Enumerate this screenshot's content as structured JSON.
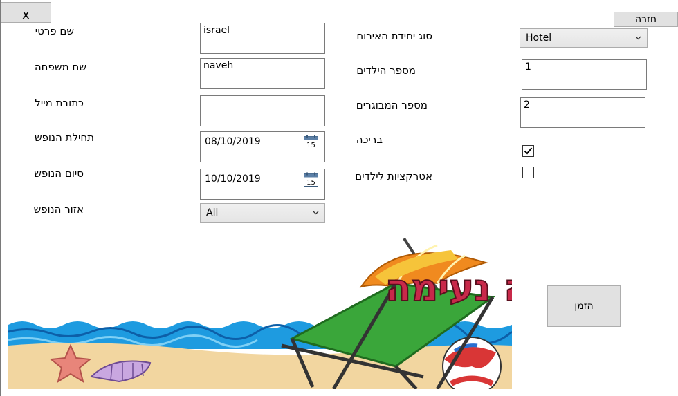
{
  "buttons": {
    "close": "x",
    "back": "חזרה",
    "book": "הזמן"
  },
  "left_form": {
    "first_name": {
      "label": "שם פרטי",
      "value": "israel"
    },
    "last_name": {
      "label": "שם משפחה",
      "value": "naveh"
    },
    "email": {
      "label": "כתובת מייל",
      "value": ""
    },
    "vacation_start": {
      "label": "תחילת הנופש",
      "value": "08/10/2019",
      "calendar_day": "15"
    },
    "vacation_end": {
      "label": "סיום הנופש",
      "value": "10/10/2019",
      "calendar_day": "15"
    },
    "area": {
      "label": "אזור הנופש",
      "value": "All"
    }
  },
  "right_form": {
    "lodging_type": {
      "label": "סוג יחידת האירוח",
      "value": "Hotel"
    },
    "children": {
      "label": "מספר הילדים",
      "value": "1"
    },
    "adults": {
      "label": "מספר המבוגרים",
      "value": "2"
    },
    "pool": {
      "label": "בריכה",
      "checked": true
    },
    "kids_attractions": {
      "label": "אטרקציות לילדים",
      "checked": false
    }
  },
  "banner": {
    "title": "חופשה נעימה"
  },
  "colors": {
    "banner_title": "#c8294a",
    "umbrella": "#f08a1f",
    "chair": "#3aa63a",
    "sea": "#1e9be0",
    "sand": "#f2d6a0"
  }
}
